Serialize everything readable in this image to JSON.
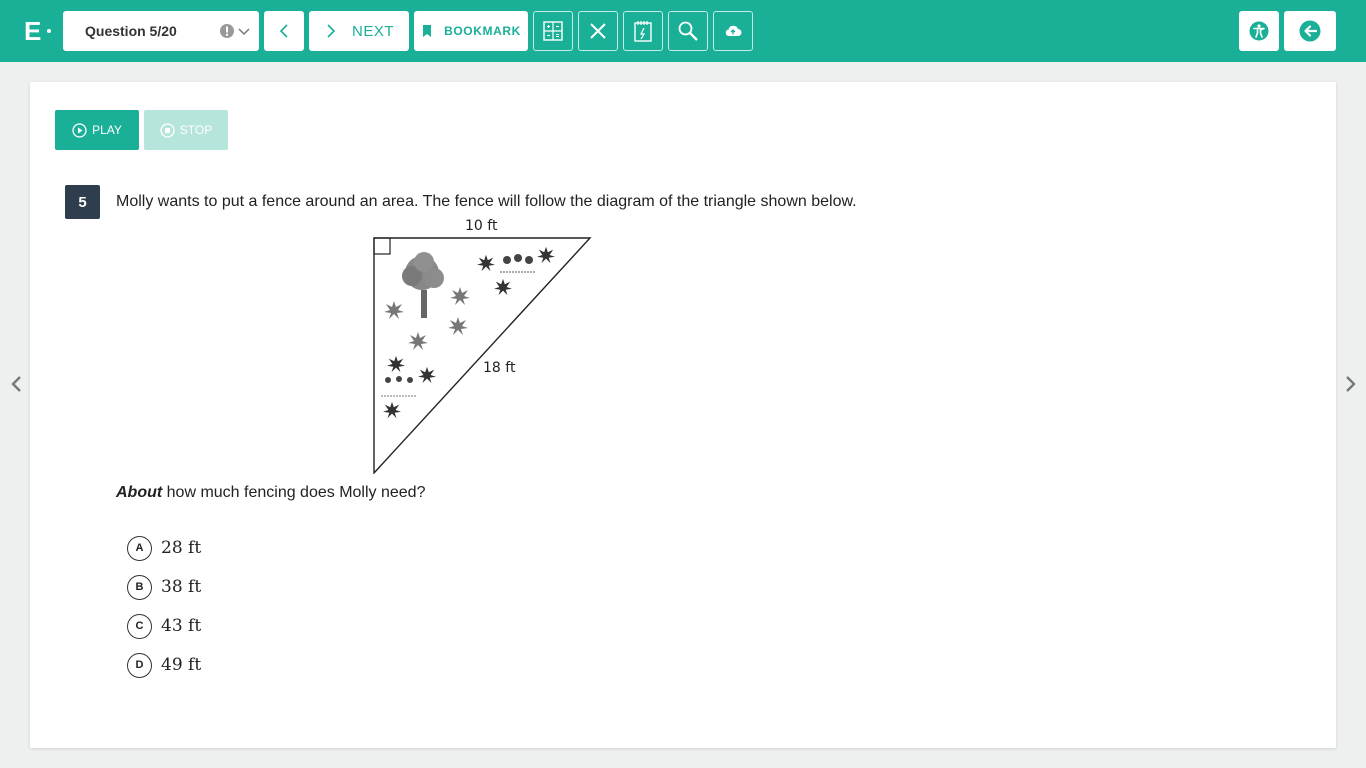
{
  "topbar": {
    "logo": "E",
    "question_select": "Question 5/20",
    "next_label": "NEXT",
    "bookmark_label": "BOOKMARK",
    "colors": {
      "bar": "#1aaf97",
      "white": "#ffffff"
    },
    "icons": [
      "warning-icon",
      "chevron-down-icon",
      "back-arrow-icon",
      "next-arrow-icon",
      "bookmark-icon",
      "calculator-icon",
      "eliminate-icon",
      "notepad-icon",
      "magnifier-icon",
      "cloud-upload-icon",
      "accessibility-icon",
      "exit-icon"
    ]
  },
  "media": {
    "play_label": "PLAY",
    "stop_label": "STOP"
  },
  "question": {
    "number": "5",
    "text": "Molly wants to put a fence around an area. The fence will follow the diagram of the triangle shown below.",
    "figure": {
      "top_label": "10 ft",
      "hyp_label": "18 ft"
    },
    "prompt_emphasis": "About",
    "prompt_rest": " how much fencing does Molly need?",
    "choices": [
      {
        "letter": "A",
        "answer": "28 ft"
      },
      {
        "letter": "B",
        "answer": "38 ft"
      },
      {
        "letter": "C",
        "answer": "43 ft"
      },
      {
        "letter": "D",
        "answer": "49 ft"
      }
    ]
  }
}
